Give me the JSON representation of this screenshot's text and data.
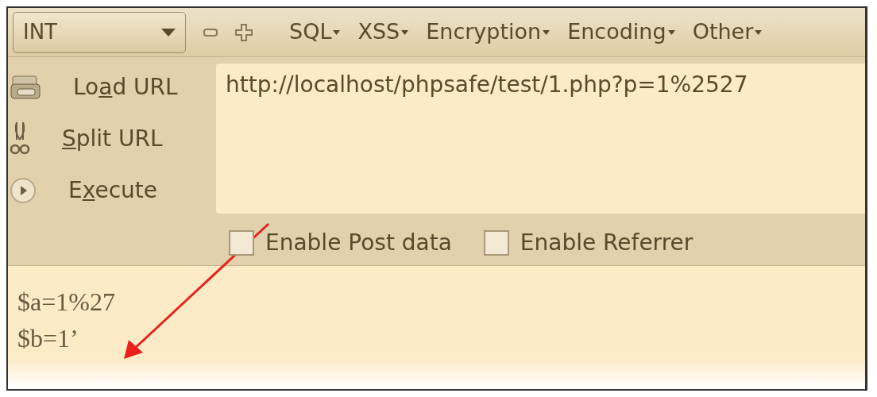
{
  "toolbar": {
    "mode_select": {
      "value": "INT"
    },
    "buttons": [
      {
        "kind": "minus"
      },
      {
        "kind": "plus"
      }
    ],
    "menus": [
      {
        "label": "SQL"
      },
      {
        "label": "XSS"
      },
      {
        "label": "Encryption"
      },
      {
        "label": "Encoding"
      },
      {
        "label": "Other"
      }
    ]
  },
  "actions": [
    {
      "kind": "load",
      "label_parts": {
        "before": "Lo",
        "key": "a",
        "after": "d URL"
      }
    },
    {
      "kind": "split",
      "label_parts": {
        "key": "S",
        "after": "plit URL"
      }
    },
    {
      "kind": "execute",
      "label_parts": {
        "before": "E",
        "key": "x",
        "after": "ecute"
      }
    }
  ],
  "url_field": {
    "value": "http://localhost/phpsafe/test/1.php?p=1%2527"
  },
  "options": [
    {
      "label": "Enable Post data",
      "checked": false
    },
    {
      "label": "Enable Referrer",
      "checked": false
    }
  ],
  "output": {
    "lines": [
      "$a=1%27",
      "$b=1’"
    ]
  }
}
